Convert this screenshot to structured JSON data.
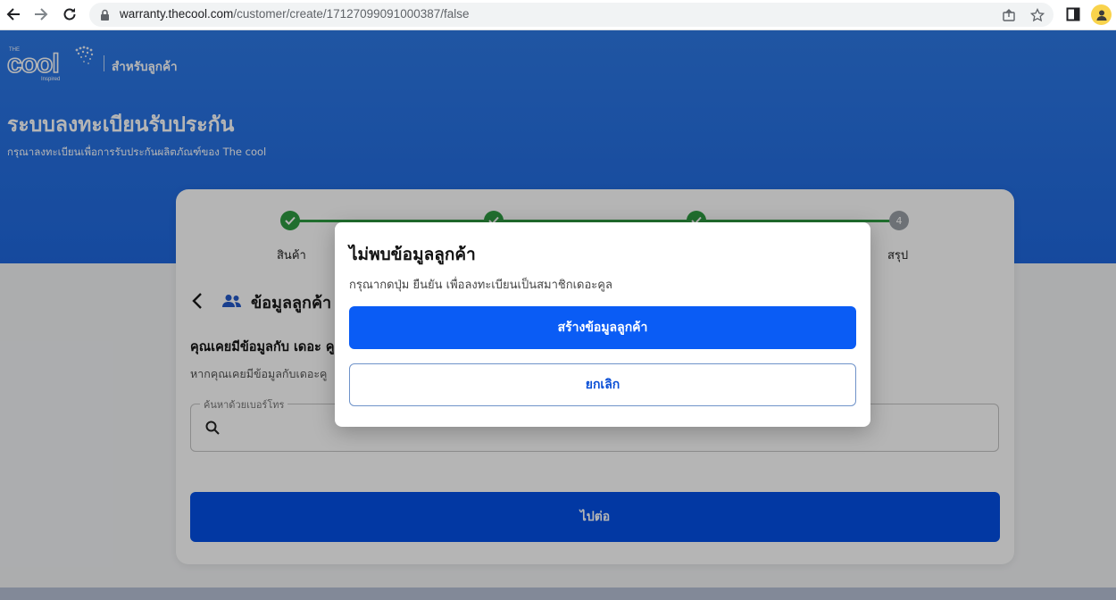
{
  "browser": {
    "url_host": "warranty.thecool.com",
    "url_path": "/customer/create/17127099091000387/false"
  },
  "header": {
    "logo_text": "cool",
    "logo_small": "THE",
    "logo_tag": "Inspired",
    "caption": "สำหรับลูกค้า",
    "title": "ระบบลงทะเบียนรับประกัน",
    "subtitle": "กรุณาลงทะเบียนเพื่อการรับประกันผลิตภัณฑ์ของ The cool"
  },
  "stepper": {
    "steps": [
      {
        "label": "สินค้า",
        "status": "done"
      },
      {
        "label": "",
        "status": "done"
      },
      {
        "label": "",
        "status": "done"
      },
      {
        "label": "สรุป",
        "status": "pending",
        "number": "4"
      }
    ]
  },
  "form": {
    "section_title": "ข้อมูลลูกค้า",
    "question": "คุณเคยมีข้อมูลกับ เดอะ คู",
    "hint": "หากคุณเคยมีข้อมูลกับเดอะคู",
    "search_label": "ค้นหาด้วยเบอร์โทร",
    "next_label": "ไปต่อ"
  },
  "dialog": {
    "title": "ไม่พบข้อมูลลูกค้า",
    "message": "กรุณากดปุ่ม ยืนยัน เพื่อลงทะเบียนเป็นสมาชิกเดอะคูล",
    "confirm_label": "สร้างข้อมูลลูกค้า",
    "cancel_label": "ยกเลิก"
  },
  "colors": {
    "brand_blue": "#1f68df",
    "primary_button": "#0a5cf5",
    "step_done": "#2e9c41"
  }
}
